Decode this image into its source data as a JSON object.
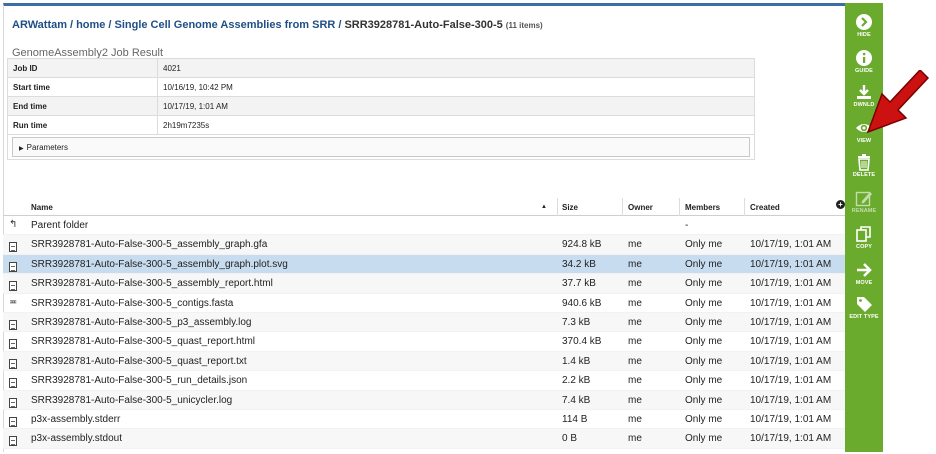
{
  "breadcrumb": {
    "root": "ARWattam",
    "home": "home",
    "folder": "Single Cell Genome Assemblies from SRR",
    "current": "SRR3928781-Auto-False-300-5",
    "count": "(11 items)",
    "sep": "/"
  },
  "job": {
    "title": "GenomeAssembly2 Job Result",
    "fields": [
      {
        "label": "Job ID",
        "value": "4021"
      },
      {
        "label": "Start time",
        "value": "10/16/19, 10:42 PM"
      },
      {
        "label": "End time",
        "value": "10/17/19, 1:01 AM"
      },
      {
        "label": "Run time",
        "value": "2h19m7235s"
      }
    ],
    "parameters_label": "Parameters"
  },
  "grid": {
    "headers": {
      "name": "Name",
      "size": "Size",
      "owner": "Owner",
      "members": "Members",
      "created": "Created"
    },
    "add_col": "+",
    "rows": [
      {
        "icon": "parent-folder-icon",
        "glyph": "↰",
        "name": "Parent folder",
        "size": "",
        "owner": "",
        "members": "-",
        "created": ""
      },
      {
        "icon": "file-icon",
        "name": "SRR3928781-Auto-False-300-5_assembly_graph.gfa",
        "size": "924.8 kB",
        "owner": "me",
        "members": "Only me",
        "created": "10/17/19, 1:01 AM"
      },
      {
        "icon": "file-icon",
        "name": "SRR3928781-Auto-False-300-5_assembly_graph.plot.svg",
        "size": "34.2 kB",
        "owner": "me",
        "members": "Only me",
        "created": "10/17/19, 1:01 AM",
        "selected": true
      },
      {
        "icon": "file-icon",
        "name": "SRR3928781-Auto-False-300-5_assembly_report.html",
        "size": "37.7 kB",
        "owner": "me",
        "members": "Only me",
        "created": "10/17/19, 1:01 AM"
      },
      {
        "icon": "contigs-icon",
        "glyph": "≖",
        "name": "SRR3928781-Auto-False-300-5_contigs.fasta",
        "size": "940.6 kB",
        "owner": "me",
        "members": "Only me",
        "created": "10/17/19, 1:01 AM"
      },
      {
        "icon": "file-icon",
        "name": "SRR3928781-Auto-False-300-5_p3_assembly.log",
        "size": "7.3 kB",
        "owner": "me",
        "members": "Only me",
        "created": "10/17/19, 1:01 AM"
      },
      {
        "icon": "file-icon",
        "name": "SRR3928781-Auto-False-300-5_quast_report.html",
        "size": "370.4 kB",
        "owner": "me",
        "members": "Only me",
        "created": "10/17/19, 1:01 AM"
      },
      {
        "icon": "file-icon",
        "name": "SRR3928781-Auto-False-300-5_quast_report.txt",
        "size": "1.4 kB",
        "owner": "me",
        "members": "Only me",
        "created": "10/17/19, 1:01 AM"
      },
      {
        "icon": "file-icon",
        "name": "SRR3928781-Auto-False-300-5_run_details.json",
        "size": "2.2 kB",
        "owner": "me",
        "members": "Only me",
        "created": "10/17/19, 1:01 AM"
      },
      {
        "icon": "file-icon",
        "name": "SRR3928781-Auto-False-300-5_unicycler.log",
        "size": "7.4 kB",
        "owner": "me",
        "members": "Only me",
        "created": "10/17/19, 1:01 AM"
      },
      {
        "icon": "file-icon",
        "name": "p3x-assembly.stderr",
        "size": "114 B",
        "owner": "me",
        "members": "Only me",
        "created": "10/17/19, 1:01 AM"
      },
      {
        "icon": "file-icon",
        "name": "p3x-assembly.stdout",
        "size": "0 B",
        "owner": "me",
        "members": "Only me",
        "created": "10/17/19, 1:01 AM"
      }
    ]
  },
  "sidebar": {
    "hide": "HIDE",
    "guide": "GUIDE",
    "download": "DWNLD",
    "view": "VIEW",
    "delete": "DELETE",
    "rename": "RENAME",
    "copy": "COPY",
    "move": "MOVE",
    "edit_type": "EDIT TYPE"
  },
  "colors": {
    "sidebar": "#6aab2e",
    "link": "#1f4f86",
    "selected_row": "#c8dcef",
    "arrow": "#cc1111"
  }
}
